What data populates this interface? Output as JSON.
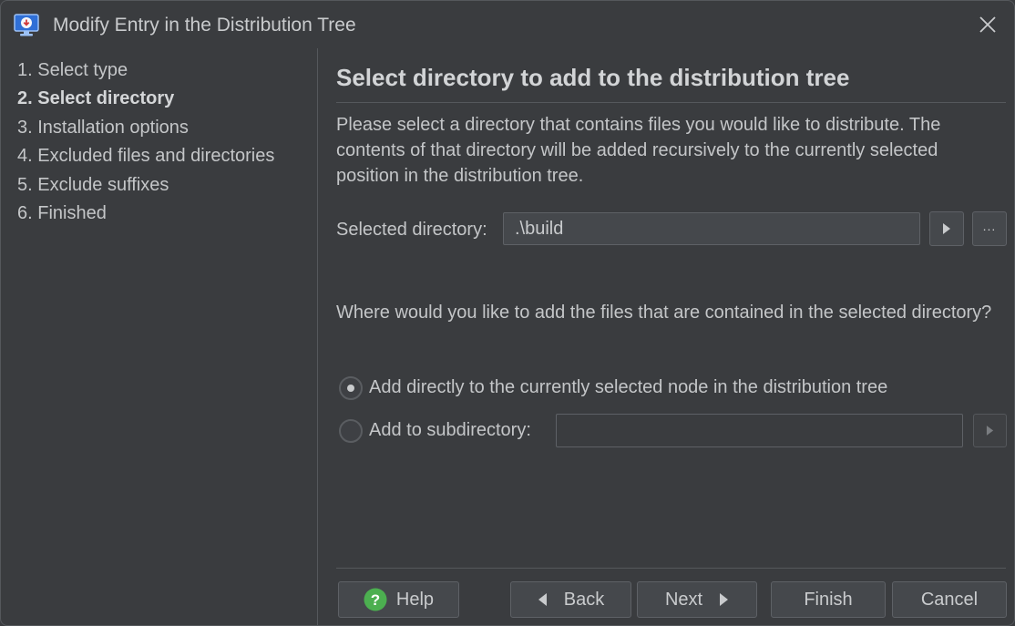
{
  "window": {
    "title": "Modify Entry in the Distribution Tree"
  },
  "steps": [
    {
      "label": "1. Select type",
      "active": false
    },
    {
      "label": "2. Select directory",
      "active": true
    },
    {
      "label": "3. Installation options",
      "active": false
    },
    {
      "label": "4. Excluded files and directories",
      "active": false
    },
    {
      "label": "5. Exclude suffixes",
      "active": false
    },
    {
      "label": "6. Finished",
      "active": false
    }
  ],
  "main": {
    "heading": "Select directory to add to the distribution tree",
    "description": "Please select a directory that contains files you would like to distribute. The contents of that directory will be added recursively to the currently selected position in the distribution tree.",
    "selected_directory_label": "Selected directory:",
    "selected_directory_value": ".\\build",
    "browse_label": "...",
    "question": "Where would you like to add the files that are contained in the selected directory?",
    "option_direct": "Add directly to the currently selected node in the distribution tree",
    "option_subdirectory": "Add to subdirectory:",
    "subdirectory_value": "",
    "selected_option": "direct"
  },
  "buttons": {
    "help": "Help",
    "back": "Back",
    "next": "Next",
    "finish": "Finish",
    "cancel": "Cancel"
  },
  "colors": {
    "background": "#3a3c3f",
    "help_icon": "#4caf50",
    "app_icon": "#2f6fd6"
  }
}
